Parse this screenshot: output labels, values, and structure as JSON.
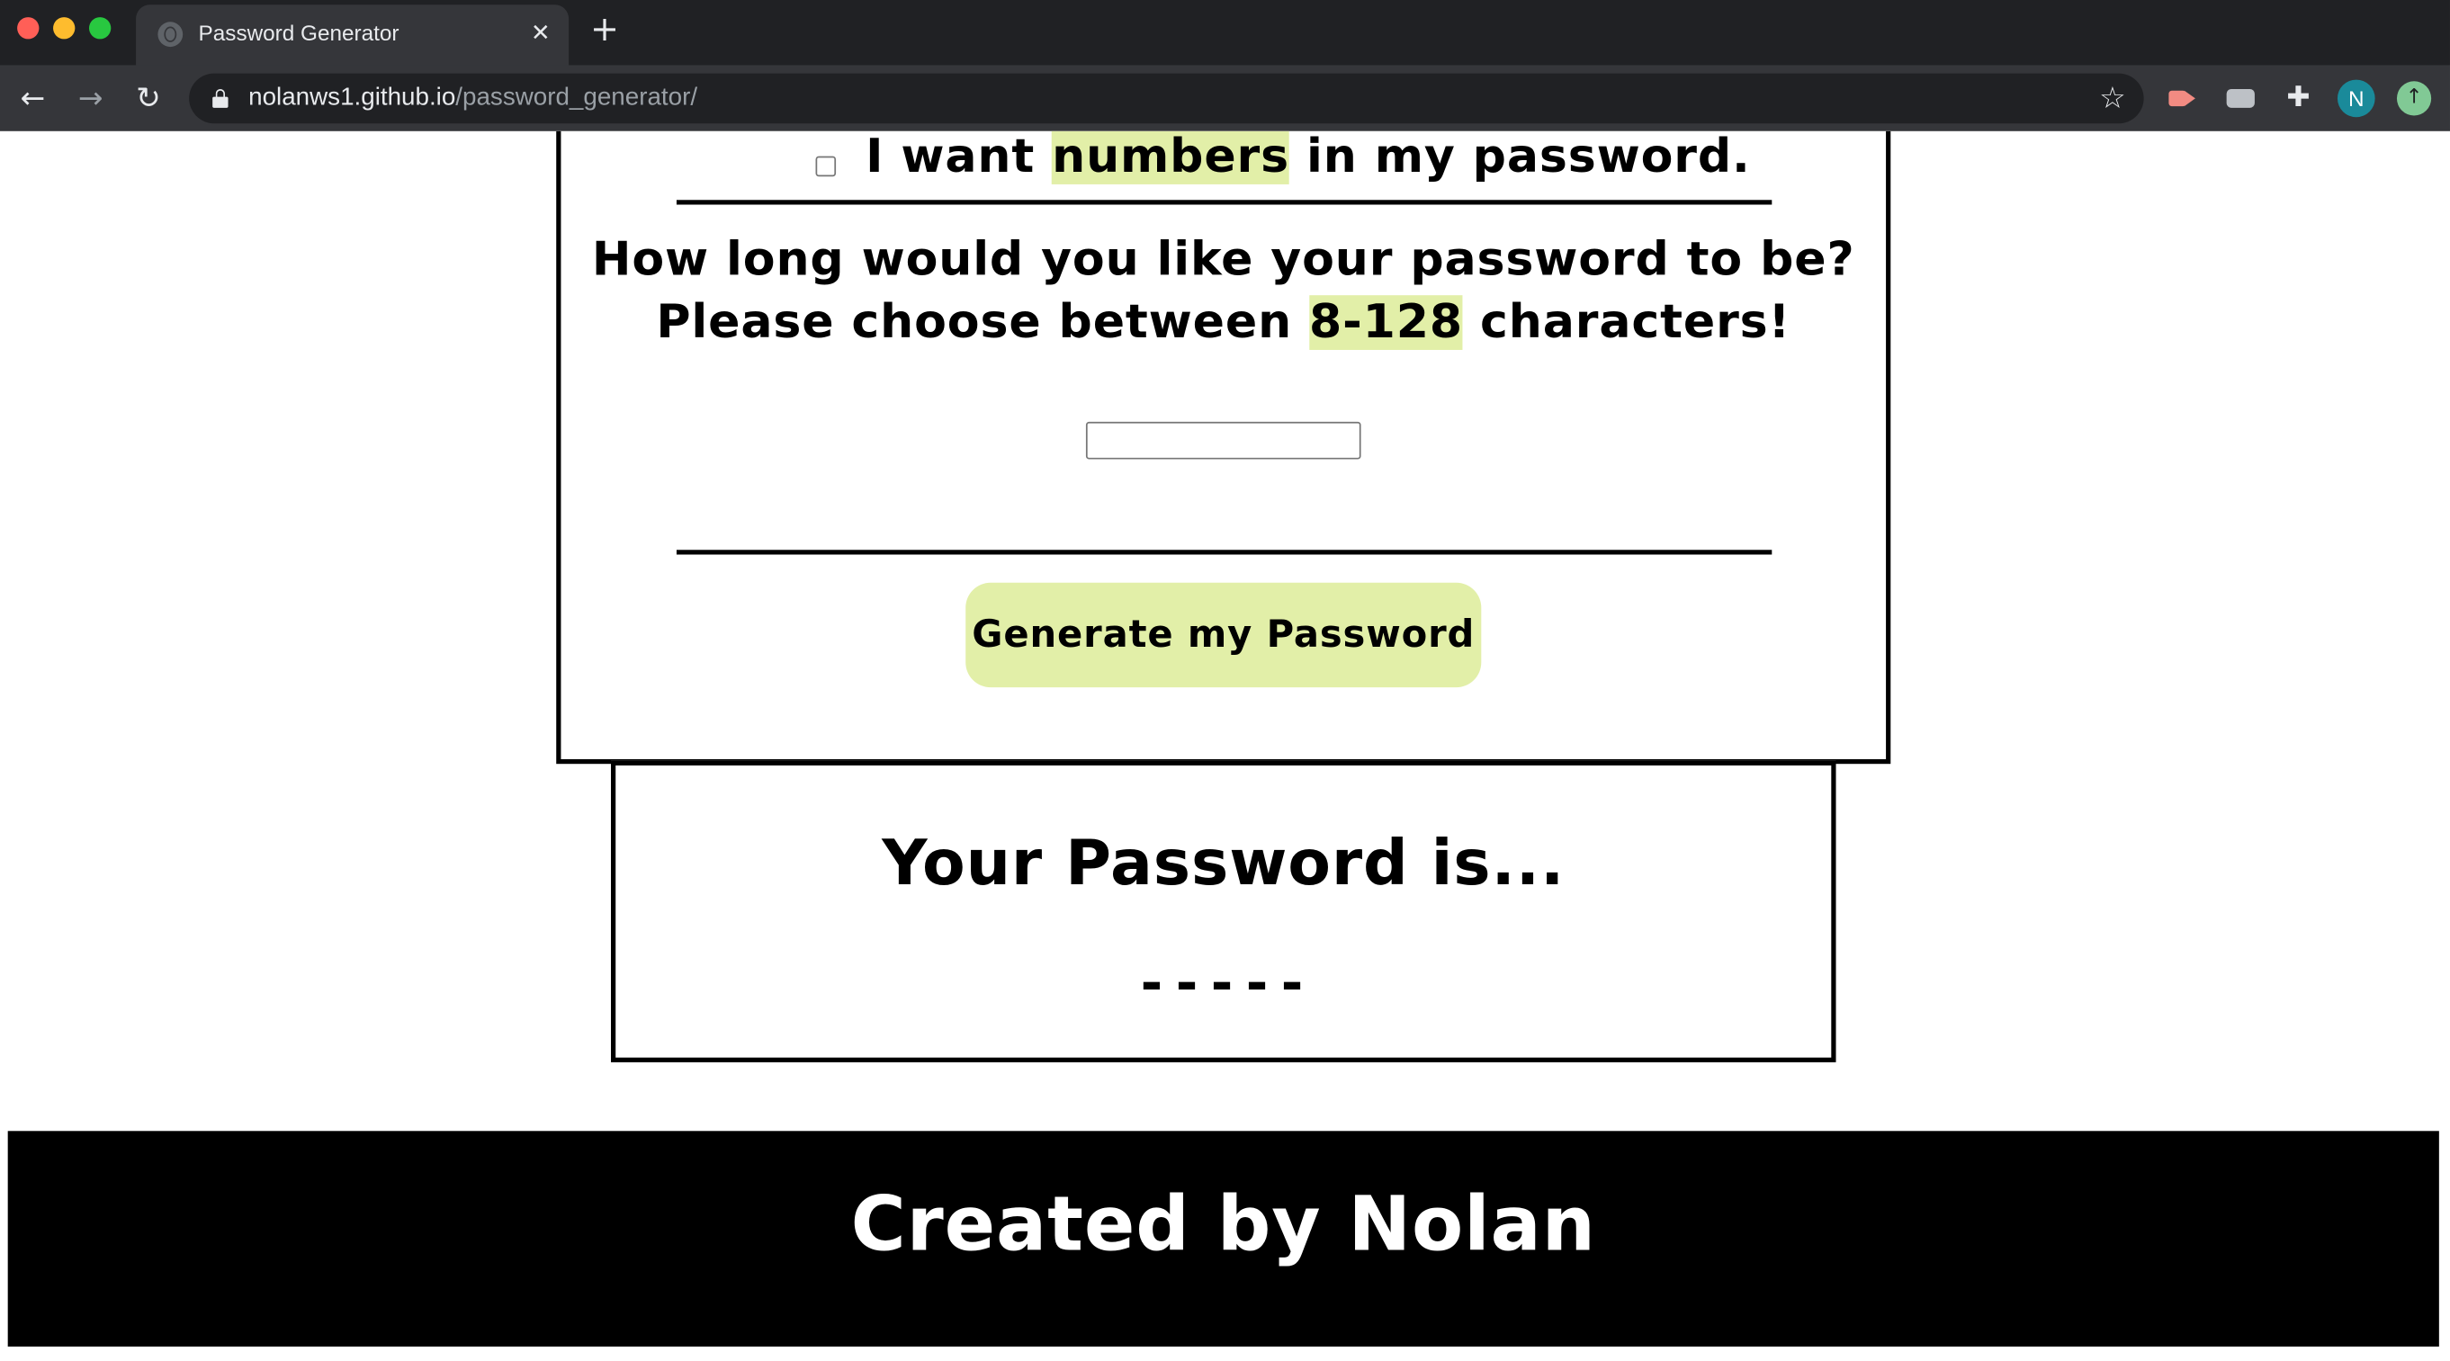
{
  "browser": {
    "tab_title": "Password Generator",
    "tab_close": "✕",
    "new_tab": "+",
    "back": "←",
    "forward": "→",
    "reload": "↻",
    "url_host": "nolanws1.github.io",
    "url_path": "/password_generator/",
    "bookmark": "☆",
    "extensions_icon": "✚",
    "profile_initial": "N",
    "update": "↑"
  },
  "criteria": {
    "numbers_prefix": "I want ",
    "numbers_highlight": "numbers",
    "numbers_suffix": " in my password."
  },
  "length": {
    "question_line1": "How long would you like your password to be?",
    "question_line2_prefix": "Please choose between ",
    "question_line2_highlight": "8-128",
    "question_line2_suffix": " characters!",
    "input_value": ""
  },
  "generate_button": "Generate my Password",
  "result": {
    "title": "Your Password is...",
    "value": "-----"
  },
  "footer": {
    "text": "Created by Nolan"
  },
  "colors": {
    "highlight": "#e2efa8",
    "border": "#000000",
    "footer_bg": "#000000",
    "footer_text": "#ffffff"
  }
}
